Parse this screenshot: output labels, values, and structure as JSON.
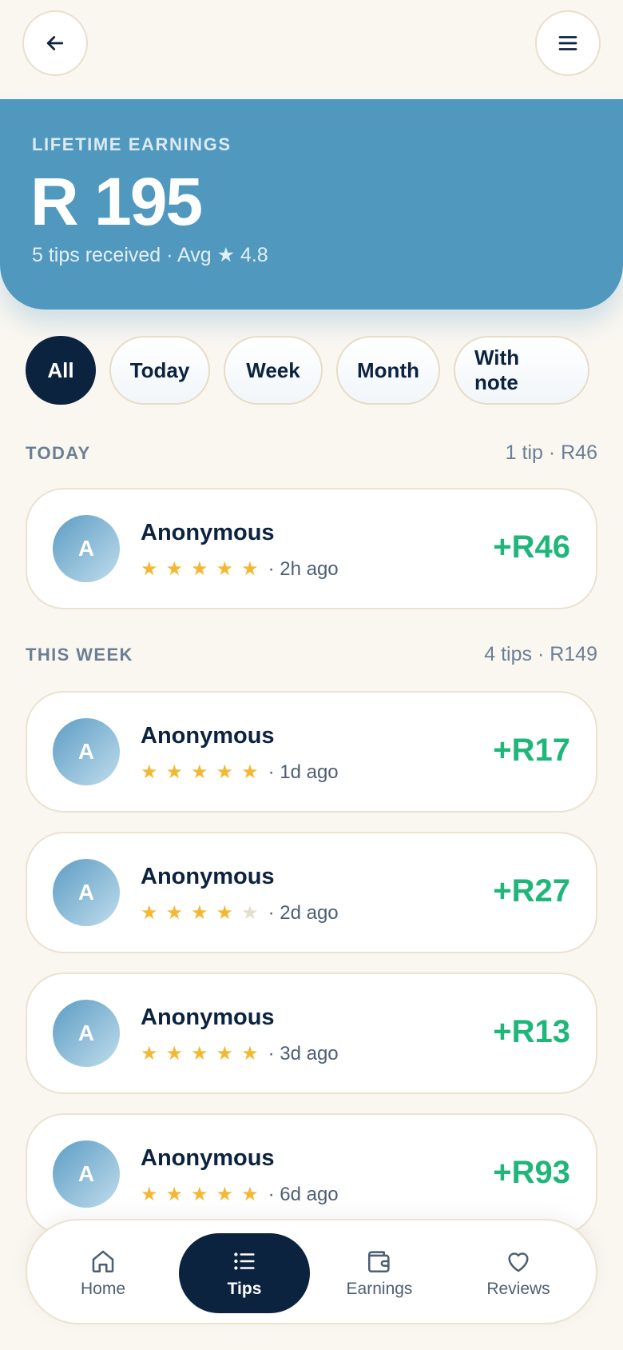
{
  "hero": {
    "label": "LIFETIME EARNINGS",
    "amount": "R 195",
    "summary": "5 tips received · Avg ★ 4.8"
  },
  "filters": [
    "All",
    "Today",
    "Week",
    "Month",
    "With note"
  ],
  "sections": {
    "today": {
      "title": "TODAY",
      "meta": "1 tip · R46"
    },
    "week": {
      "title": "THIS WEEK",
      "meta": "4 tips · R149"
    }
  },
  "tips": [
    {
      "initial": "A",
      "name": "Anonymous",
      "rating": 5,
      "when": "· 2h ago",
      "amount": "+R46"
    },
    {
      "initial": "A",
      "name": "Anonymous",
      "rating": 5,
      "when": "· 1d ago",
      "amount": "+R17"
    },
    {
      "initial": "A",
      "name": "Anonymous",
      "rating": 4,
      "when": "· 2d ago",
      "amount": "+R27"
    },
    {
      "initial": "A",
      "name": "Anonymous",
      "rating": 5,
      "when": "· 3d ago",
      "amount": "+R13"
    },
    {
      "initial": "A",
      "name": "Anonymous",
      "rating": 5,
      "when": "· 6d ago",
      "amount": "+R93"
    }
  ],
  "nav": [
    {
      "label": "Home",
      "icon": "home-icon"
    },
    {
      "label": "Tips",
      "icon": "list-icon"
    },
    {
      "label": "Earnings",
      "icon": "wallet-icon"
    },
    {
      "label": "Reviews",
      "icon": "heart-icon"
    }
  ],
  "colors": {
    "hero": "#5198bf",
    "primary": "#0c2340",
    "amount": "#1fb67a",
    "star": "#f5b731",
    "background": "#faf7f1"
  }
}
